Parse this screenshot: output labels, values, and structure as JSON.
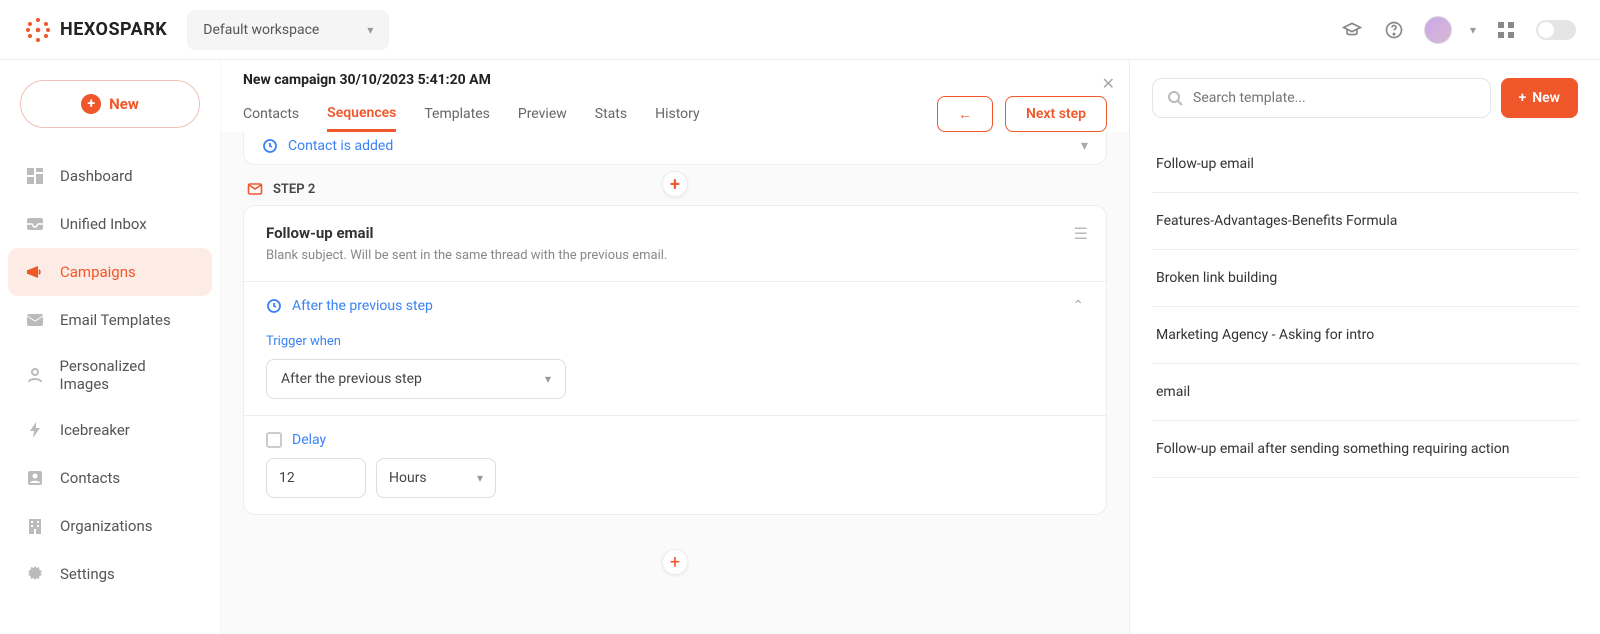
{
  "brand": "HEXOSPARK",
  "workspace_selected": "Default workspace",
  "new_button_label": "New",
  "sidebar": {
    "items": [
      {
        "label": "Dashboard"
      },
      {
        "label": "Unified Inbox"
      },
      {
        "label": "Campaigns"
      },
      {
        "label": "Email Templates"
      },
      {
        "label": "Personalized Images"
      },
      {
        "label": "Icebreaker"
      },
      {
        "label": "Contacts"
      },
      {
        "label": "Organizations"
      },
      {
        "label": "Settings"
      }
    ],
    "active_index": 2
  },
  "campaign": {
    "title": "New campaign 30/10/2023 5:41:20 AM",
    "tabs": [
      "Contacts",
      "Sequences",
      "Templates",
      "Preview",
      "Stats",
      "History"
    ],
    "active_tab": 1,
    "back_label": "←",
    "next_label": "Next step",
    "trigger_peek": "Contact is added",
    "step_label": "STEP 2",
    "card": {
      "title": "Follow-up email",
      "subtitle": "Blank subject. Will be sent in the same thread with the previous email.",
      "after_label": "After the previous step",
      "trigger_when_label": "Trigger when",
      "trigger_select": "After the previous step",
      "delay_label": "Delay",
      "delay_value": "12",
      "delay_unit": "Hours"
    }
  },
  "right": {
    "search_placeholder": "Search template...",
    "new_label": "New",
    "templates": [
      "Follow-up email",
      "Features-Advantages-Benefits Formula",
      "Broken link building",
      "Marketing Agency - Asking for intro",
      "email",
      "Follow-up email after sending something requiring action"
    ]
  }
}
